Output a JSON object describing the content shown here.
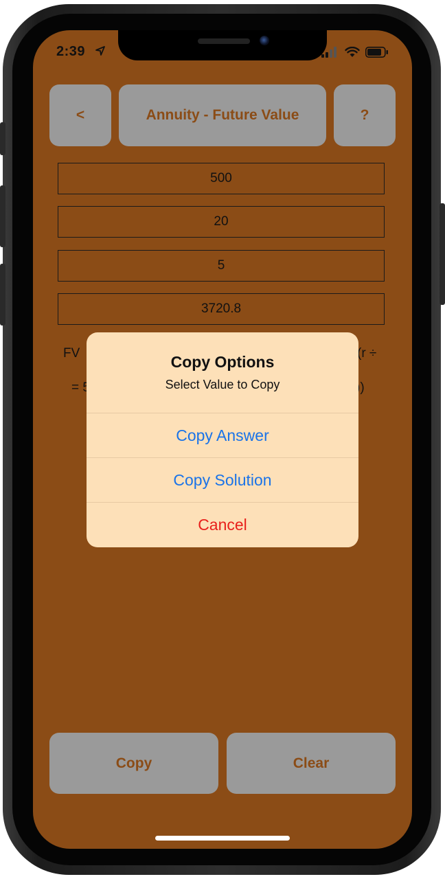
{
  "status_bar": {
    "time": "2:39"
  },
  "header": {
    "back_label": "<",
    "title": "Annuity - Future Value",
    "help_label": "?"
  },
  "fields": [
    {
      "value": "500"
    },
    {
      "value": "20"
    },
    {
      "value": "5"
    },
    {
      "value": "3720.8"
    }
  ],
  "formula": {
    "line1_left": "FV",
    "line1_right": "(r ÷",
    "line2_left": "= 5",
    "line2_right": "))"
  },
  "alert": {
    "title": "Copy Options",
    "message": "Select Value to Copy",
    "actions": [
      {
        "label": "Copy Answer",
        "color": "#1a73e8"
      },
      {
        "label": "Copy Solution",
        "color": "#1a73e8"
      },
      {
        "label": "Cancel",
        "color": "#e8201b"
      }
    ]
  },
  "footer": {
    "copy_label": "Copy",
    "clear_label": "Clear"
  },
  "colors": {
    "background": "#8b4c16",
    "button": "#9a9a9a",
    "alert_bg": "#fde0b8"
  }
}
